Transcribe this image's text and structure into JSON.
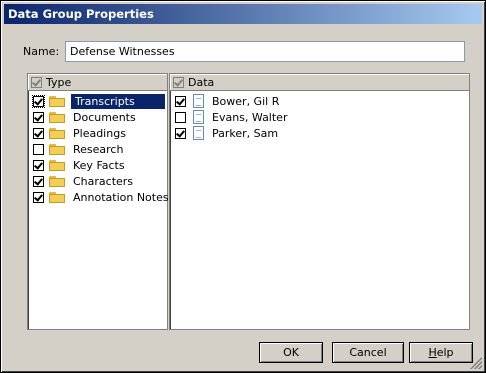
{
  "window": {
    "title": "Data Group Properties"
  },
  "name": {
    "label": "Name:",
    "value": "Defense Witnesses"
  },
  "type_panel": {
    "header": "Type",
    "items": [
      {
        "label": "Transcripts",
        "checked": true,
        "selected": true
      },
      {
        "label": "Documents",
        "checked": true
      },
      {
        "label": "Pleadings",
        "checked": true
      },
      {
        "label": "Research",
        "checked": false
      },
      {
        "label": "Key Facts",
        "checked": true
      },
      {
        "label": "Characters",
        "checked": true
      },
      {
        "label": "Annotation Notes",
        "checked": true
      }
    ]
  },
  "data_panel": {
    "header": "Data",
    "items": [
      {
        "label": "Bower, Gil R",
        "checked": true
      },
      {
        "label": "Evans, Walter",
        "checked": false
      },
      {
        "label": "Parker, Sam",
        "checked": true
      }
    ]
  },
  "buttons": {
    "ok": "OK",
    "cancel": "Cancel",
    "help_u": "H",
    "help_rest": "elp"
  },
  "colors": {
    "title_bar": "#0a246a",
    "dialog_bg": "#d4d0c8",
    "selection": "#0a246a"
  }
}
